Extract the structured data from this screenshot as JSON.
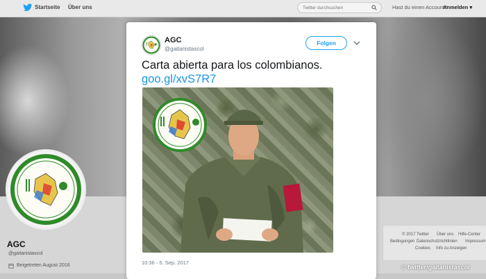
{
  "nav": {
    "home_label": "Startseite",
    "about_label": "Über uns",
    "search_placeholder": "Twitter durchsuchen",
    "account_prompt": "Hast du einen Account?",
    "login_label": "Anmelden"
  },
  "profile": {
    "name": "AGC",
    "handle": "@gaitanistascol",
    "joined": "Beigetreten August 2016"
  },
  "footer": {
    "links": [
      "© 2017 Twitter",
      "Über uns",
      "Hilfe-Center",
      "Bedingungen",
      "Datenschutzrichtlinien",
      "Impressum",
      "Cookies",
      "Info zu Anzeigen"
    ]
  },
  "tweet": {
    "author_name": "AGC",
    "author_handle": "@gaitanistascol",
    "follow_label": "Folgen",
    "text": "Carta abierta para los colombianos.",
    "link": "goo.gl/xvS7R7",
    "timestamp": "10:36 - 5. Sep. 2017"
  },
  "credit": "© twitter/gaitanistascol",
  "colors": {
    "twitter_blue": "#1da1f2",
    "link_blue": "#1b95e0",
    "badge_green": "#2f8a2a"
  },
  "icons": [
    "twitter-bird-icon",
    "search-icon",
    "caret-down-icon",
    "chevron-down-icon",
    "calendar-icon"
  ]
}
